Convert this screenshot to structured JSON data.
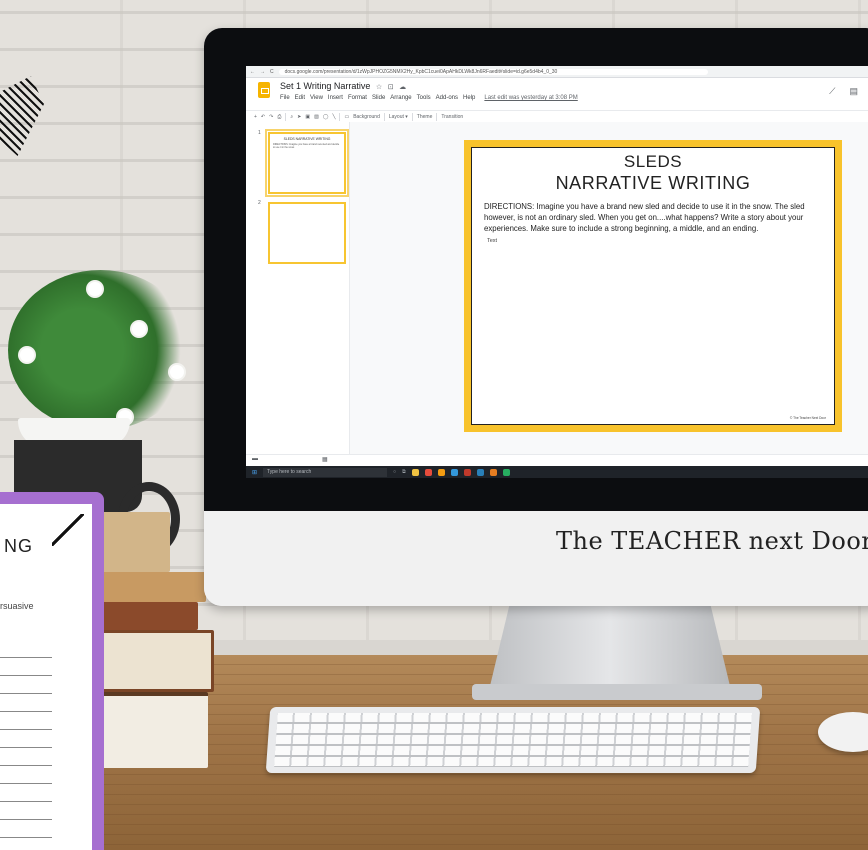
{
  "browser": {
    "address": "docs.google.com/presentation/d/1zWpJPHOZG5NMX2Hy_KpbC1cuei0ApAHkDLWk8Jn6RFaedit#slide=id.g6e5d4b4_0_30",
    "nav_glyphs": [
      "←",
      "→",
      "C"
    ]
  },
  "slides_app": {
    "doc_title": "Set 1 Writing Narrative",
    "title_icons": [
      "☆",
      "⊡",
      "☁"
    ],
    "menu": [
      "File",
      "Edit",
      "View",
      "Insert",
      "Format",
      "Slide",
      "Arrange",
      "Tools",
      "Add-ons",
      "Help"
    ],
    "last_edit": "Last edit was yesterday at 3:08 PM",
    "toolbar": {
      "background": "Background",
      "layout": "Layout ▾",
      "theme": "Theme",
      "transition": "Transition"
    },
    "thumbnails": [
      {
        "num": "1",
        "title": "SLEDS NARRATIVE WRITING",
        "body": "DIRECTIONS: Imagine you have a brand new sled and decide to use it in the snow."
      },
      {
        "num": "2"
      }
    ]
  },
  "slide": {
    "heading_1": "SLEDS",
    "heading_2": "NARRATIVE WRITING",
    "directions": "DIRECTIONS: Imagine you have a brand new sled and decide to use it in the snow. The sled however, is not an ordinary sled. When you get on....what happens? Write a story about your experiences. Make sure to include a strong beginning, a middle, and an ending.",
    "text_placeholder": "Text",
    "copyright": "© The Teacher Next Door",
    "border_color": "#f8c32c"
  },
  "taskbar": {
    "search_placeholder": "Type here to search"
  },
  "monitor": {
    "brand": "The TEACHER next Door"
  },
  "worksheet": {
    "title": "NG",
    "subtitle": "rsuasive",
    "accent": "#a66fd0"
  }
}
